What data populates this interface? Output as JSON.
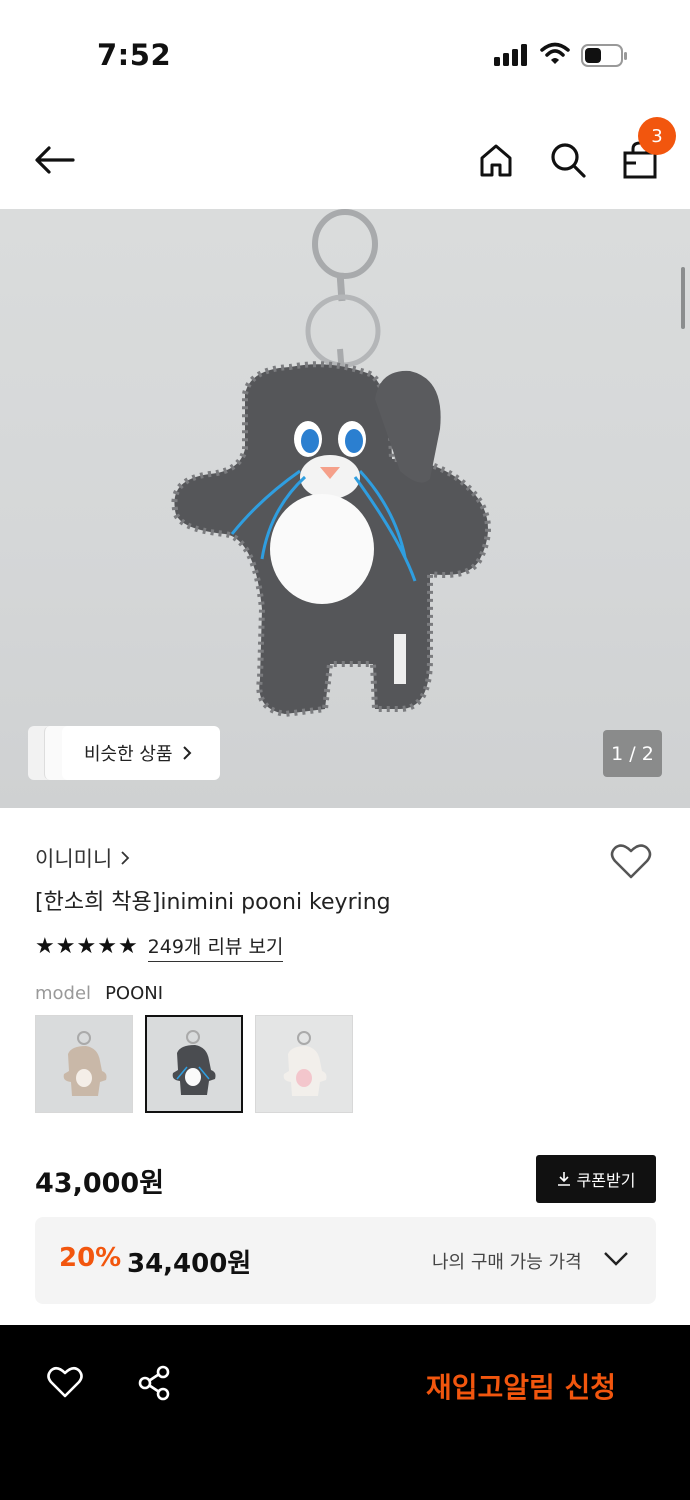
{
  "status_bar": {
    "time": "7:52"
  },
  "nav": {
    "cart_count": "3"
  },
  "hero": {
    "similar_label": "비슷한 상품",
    "pager": "1 / 2",
    "image_alt": "inimini pooni keyring gray bunny plush"
  },
  "product": {
    "brand": "이니미니",
    "name": "[한소희 착용]inimini pooni keyring",
    "rating_stars": 5,
    "review_link": "249개 리뷰 보기",
    "model_label": "model",
    "model_value": "POONI",
    "options": [
      {
        "color": "#c9b8a8",
        "selected": false
      },
      {
        "color": "#4a4c50",
        "selected": true
      },
      {
        "color": "#ece8e4",
        "selected": false
      }
    ]
  },
  "pricing": {
    "price": "43,000원",
    "coupon_label": "쿠폰받기",
    "discount_pct": "20%",
    "discount_price": "34,400원",
    "my_price_label": "나의 구매 가능 가격"
  },
  "bottom_bar": {
    "restock_label": "재입고알림 신청"
  },
  "colors": {
    "accent": "#f2560e",
    "dark": "#111111"
  }
}
